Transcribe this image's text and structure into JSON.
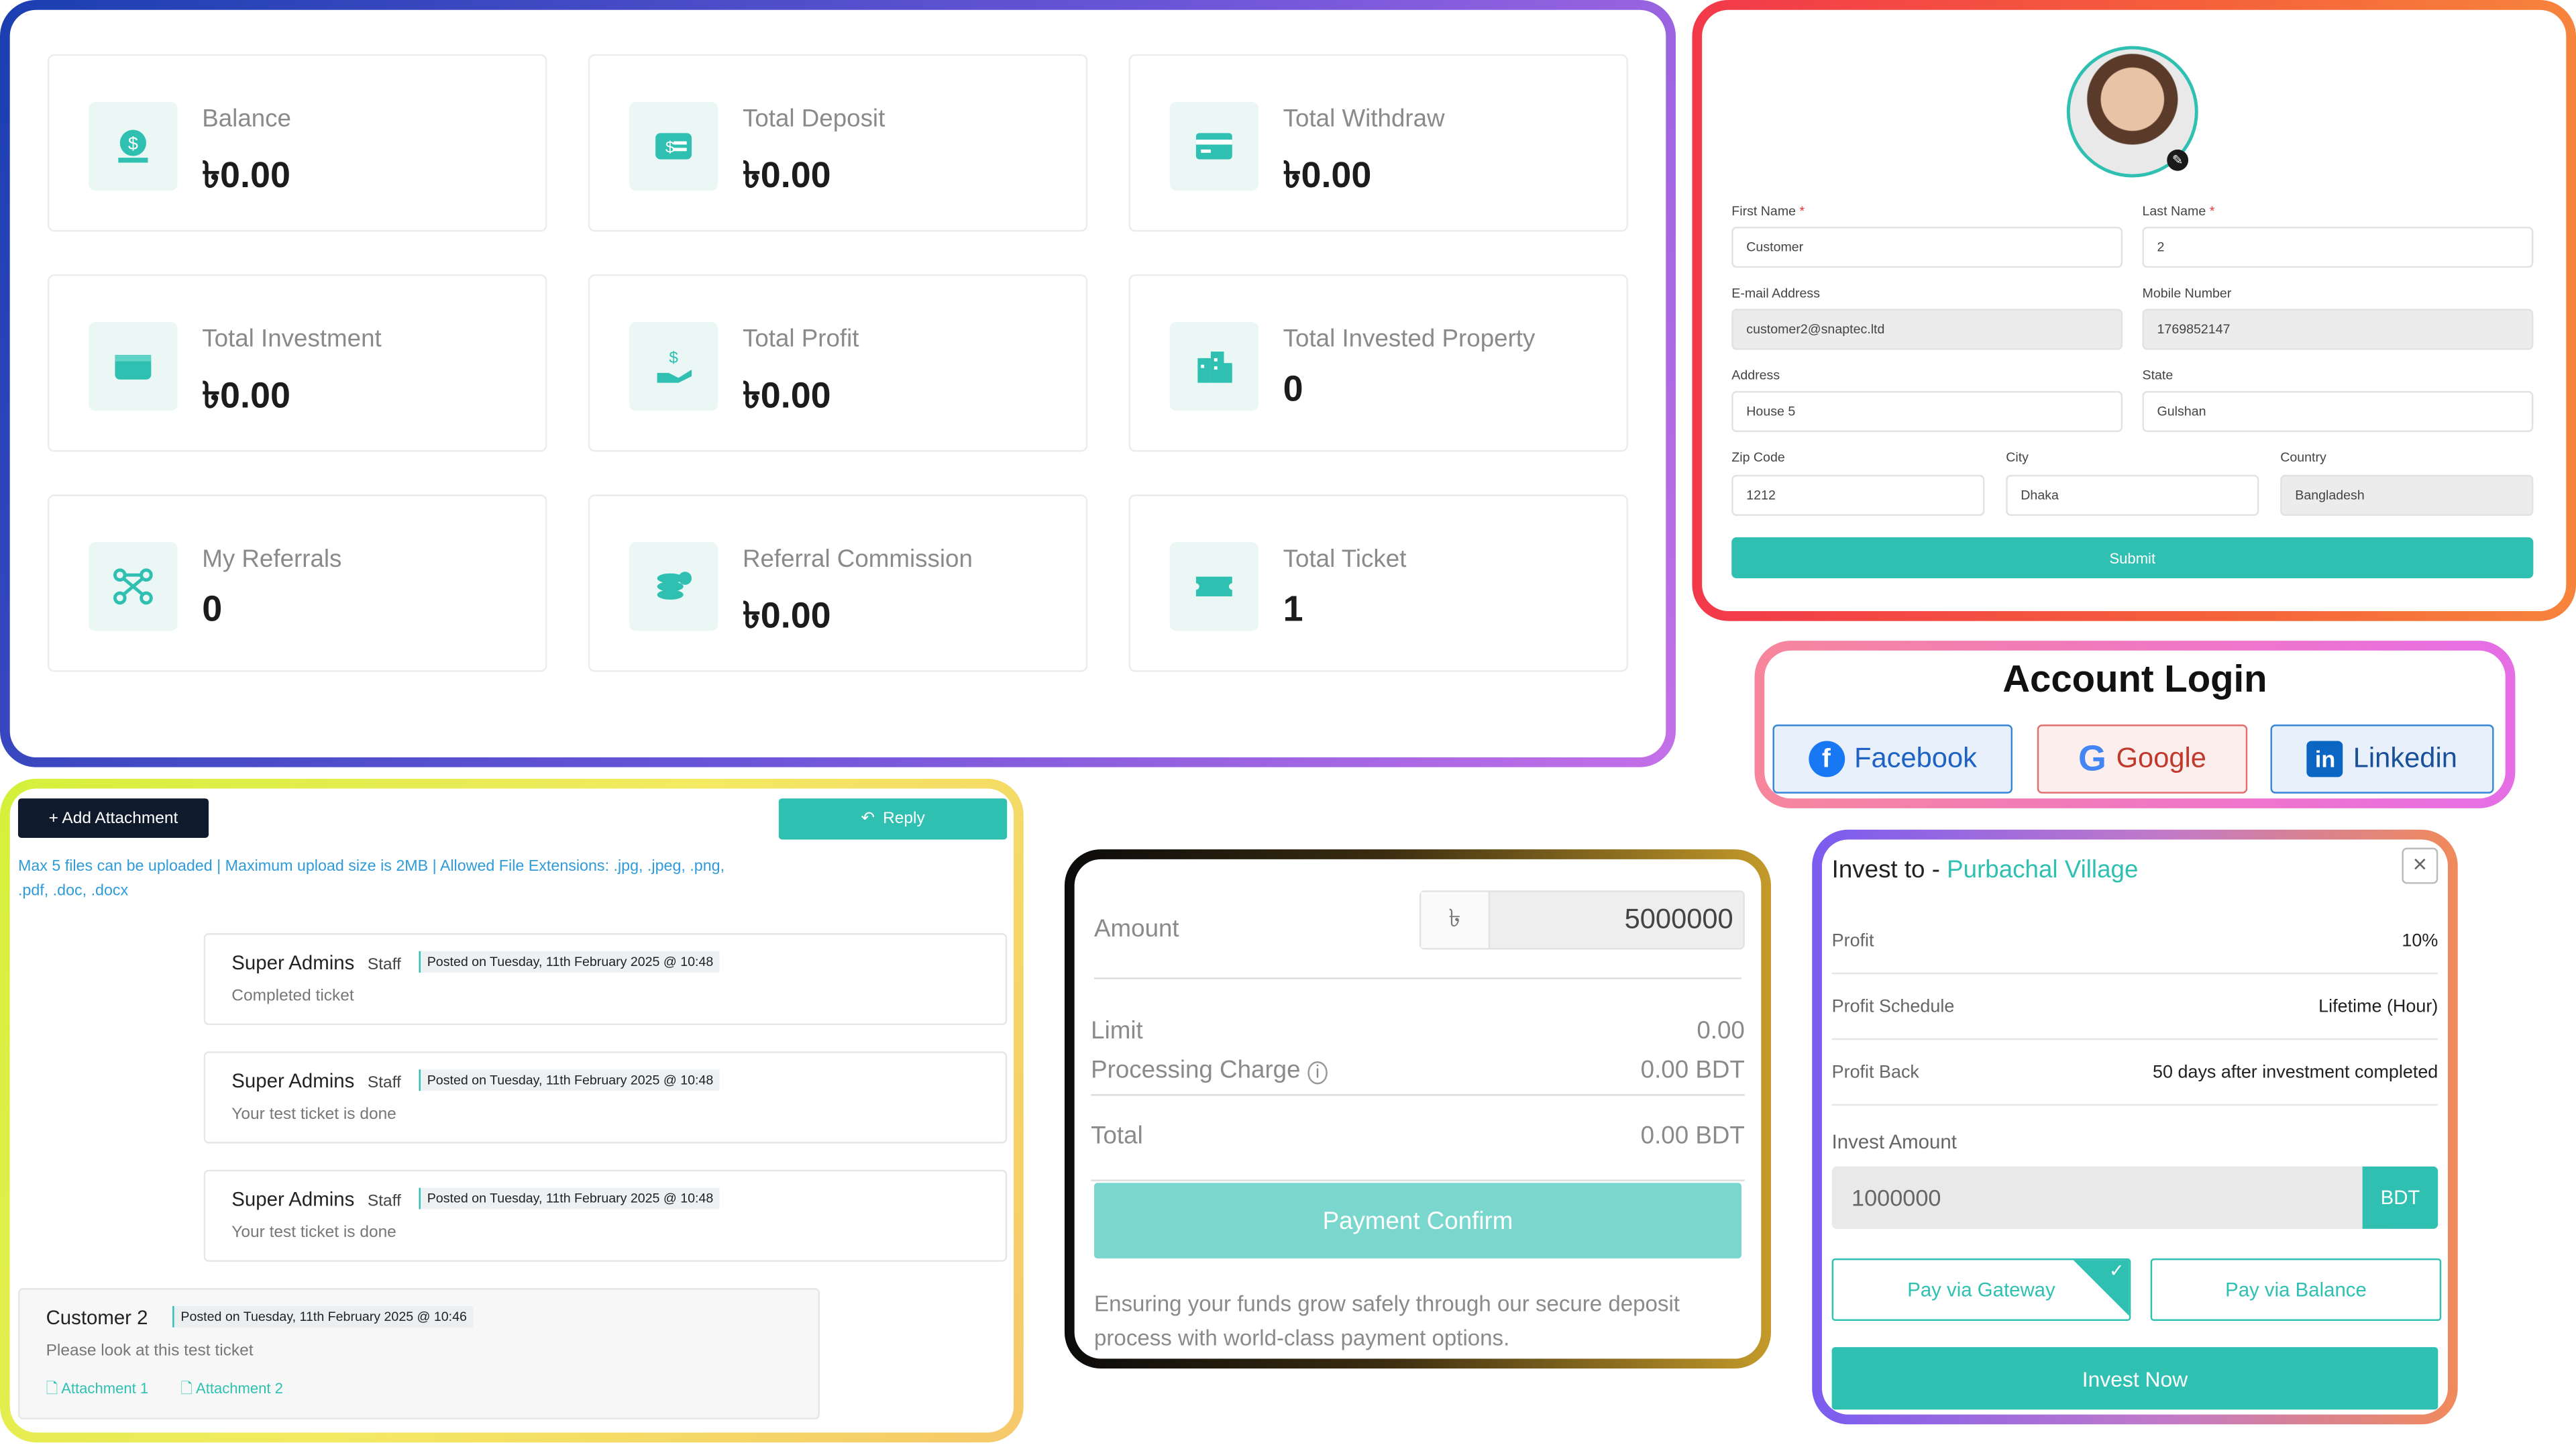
{
  "currency_symbol": "৳",
  "stats": [
    {
      "label": "Balance",
      "value": "৳0.00",
      "icon": "money-bag-icon"
    },
    {
      "label": "Total Deposit",
      "value": "৳0.00",
      "icon": "deposit-card-icon"
    },
    {
      "label": "Total Withdraw",
      "value": "৳0.00",
      "icon": "credit-card-icon"
    },
    {
      "label": "Total Investment",
      "value": "৳0.00",
      "icon": "wallet-icon"
    },
    {
      "label": "Total Profit",
      "value": "৳0.00",
      "icon": "hand-dollar-icon"
    },
    {
      "label": "Total Invested Property",
      "value": "0",
      "icon": "buildings-icon"
    },
    {
      "label": "My Referrals",
      "value": "0",
      "icon": "network-icon"
    },
    {
      "label": "Referral Commission",
      "value": "৳0.00",
      "icon": "coins-icon"
    },
    {
      "label": "Total Ticket",
      "value": "1",
      "icon": "ticket-icon"
    }
  ],
  "profile": {
    "first_name_label": "First Name",
    "first_name": "Customer",
    "last_name_label": "Last Name",
    "last_name": "2",
    "email_label": "E-mail Address",
    "email": "customer2@snaptec.ltd",
    "mobile_label": "Mobile Number",
    "mobile": "1769852147",
    "address_label": "Address",
    "address": "House 5",
    "state_label": "State",
    "state": "Gulshan",
    "zip_label": "Zip Code",
    "zip": "1212",
    "city_label": "City",
    "city": "Dhaka",
    "country_label": "Country",
    "country": "Bangladesh",
    "required_mark": "*",
    "submit_label": "Submit"
  },
  "login": {
    "title": "Account Login",
    "facebook": "Facebook",
    "google": "Google",
    "linkedin": "Linkedin"
  },
  "ticket": {
    "add_attachment": "+ Add Attachment",
    "reply": "Reply",
    "upload_note": "Max 5 files can be uploaded | Maximum upload size is 2MB | Allowed File Extensions: .jpg, .jpeg, .png, .pdf, .doc, .docx",
    "messages": [
      {
        "author": "Super Admins",
        "role": "Staff",
        "posted": "Posted on Tuesday, 11th February 2025 @ 10:48",
        "text": "Completed ticket"
      },
      {
        "author": "Super Admins",
        "role": "Staff",
        "posted": "Posted on Tuesday, 11th February 2025 @ 10:48",
        "text": "Your test ticket is done"
      },
      {
        "author": "Super Admins",
        "role": "Staff",
        "posted": "Posted on Tuesday, 11th February 2025 @ 10:48",
        "text": "Your test ticket is done"
      }
    ],
    "customer": {
      "author": "Customer 2",
      "posted": "Posted on Tuesday, 11th February 2025 @ 10:46",
      "text": "Please look at this test ticket",
      "attachment1": "Attachment 1",
      "attachment2": "Attachment 2"
    }
  },
  "payment": {
    "amount_label": "Amount",
    "amount": "5000000",
    "limit_label": "Limit",
    "limit": "0.00",
    "charge_label": "Processing Charge",
    "charge": "0.00 BDT",
    "total_label": "Total",
    "total": "0.00 BDT",
    "confirm": "Payment Confirm",
    "note": "Ensuring your funds grow safely through our secure deposit process with world-class payment options."
  },
  "invest": {
    "title_prefix": "Invest to - ",
    "property": "Purbachal Village",
    "profit_label": "Profit",
    "profit": "10%",
    "schedule_label": "Profit Schedule",
    "schedule": "Lifetime (Hour)",
    "back_label": "Profit Back",
    "back": "50 days after investment completed",
    "amount_label": "Invest Amount",
    "amount": "1000000",
    "currency": "BDT",
    "gateway": "Pay via Gateway",
    "balance": "Pay via Balance",
    "invest_now": "Invest Now"
  },
  "colors": {
    "accent": "#2fc0b2",
    "dark": "#0f1b2d"
  }
}
